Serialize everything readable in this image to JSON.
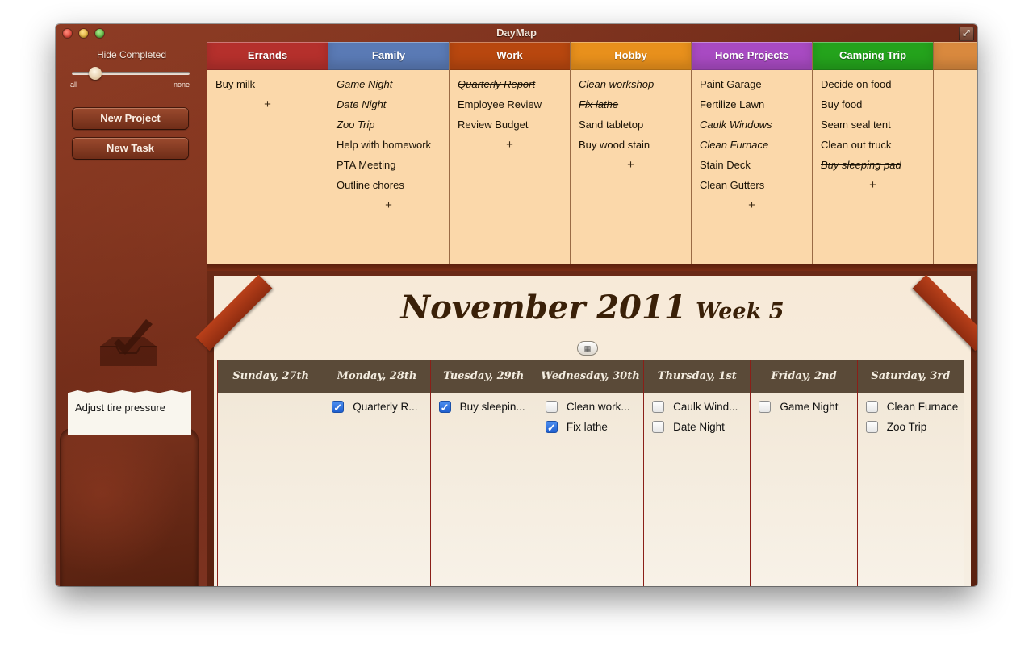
{
  "window": {
    "title": "DayMap"
  },
  "sidebar": {
    "hide_completed_label": "Hide Completed",
    "slider": {
      "min_label": "all",
      "max_label": "none",
      "position": 0.2
    },
    "buttons": {
      "new_project": "New Project",
      "new_task": "New Task"
    },
    "pocket_note": "Adjust tire pressure"
  },
  "projects": [
    {
      "name": "Errands",
      "color": "#b5302c",
      "tasks": [
        {
          "text": "Buy milk",
          "style": "normal"
        }
      ]
    },
    {
      "name": "Family",
      "color": "#5a7ab5",
      "tasks": [
        {
          "text": "Game Night",
          "style": "italic"
        },
        {
          "text": "Date Night",
          "style": "italic"
        },
        {
          "text": "Zoo Trip",
          "style": "italic"
        },
        {
          "text": "Help with homework",
          "style": "normal"
        },
        {
          "text": "PTA Meeting",
          "style": "normal"
        },
        {
          "text": "Outline chores",
          "style": "normal"
        }
      ]
    },
    {
      "name": "Work",
      "color": "#b8470f",
      "tasks": [
        {
          "text": "Quarterly Report",
          "style": "done"
        },
        {
          "text": "Employee Review",
          "style": "normal"
        },
        {
          "text": "Review Budget",
          "style": "normal"
        }
      ]
    },
    {
      "name": "Hobby",
      "color": "#e8901c",
      "tasks": [
        {
          "text": "Clean workshop",
          "style": "italic"
        },
        {
          "text": "Fix lathe",
          "style": "done"
        },
        {
          "text": "Sand tabletop",
          "style": "normal"
        },
        {
          "text": "Buy wood stain",
          "style": "normal"
        }
      ]
    },
    {
      "name": "Home Projects",
      "color": "#a84ac2",
      "tasks": [
        {
          "text": "Paint Garage",
          "style": "normal"
        },
        {
          "text": "Fertilize Lawn",
          "style": "normal"
        },
        {
          "text": "Caulk Windows",
          "style": "italic"
        },
        {
          "text": "Clean Furnace",
          "style": "italic"
        },
        {
          "text": "Stain Deck",
          "style": "normal"
        },
        {
          "text": "Clean Gutters",
          "style": "normal"
        }
      ]
    },
    {
      "name": "Camping Trip",
      "color": "#24a31c",
      "tasks": [
        {
          "text": "Decide on food",
          "style": "normal"
        },
        {
          "text": "Buy food",
          "style": "normal"
        },
        {
          "text": "Seam seal tent",
          "style": "normal"
        },
        {
          "text": "Clean out truck",
          "style": "normal"
        },
        {
          "text": "Buy sleeping pad",
          "style": "done"
        }
      ]
    },
    {
      "name": "",
      "color": "#d9893e",
      "tasks": []
    }
  ],
  "add_task_symbol": "+",
  "calendar": {
    "month": "November 2011",
    "week": "Week 5",
    "toggle_icon": "▦",
    "days": [
      {
        "label": "Sunday, 27th",
        "tasks": []
      },
      {
        "label": "Monday, 28th",
        "tasks": [
          {
            "text": "Quarterly R...",
            "checked": true
          }
        ]
      },
      {
        "label": "Tuesday, 29th",
        "tasks": [
          {
            "text": "Buy sleepin...",
            "checked": true
          }
        ]
      },
      {
        "label": "Wednesday, 30th",
        "tasks": [
          {
            "text": "Clean work...",
            "checked": false
          },
          {
            "text": "Fix lathe",
            "checked": true
          }
        ]
      },
      {
        "label": "Thursday, 1st",
        "tasks": [
          {
            "text": "Caulk Wind...",
            "checked": false
          },
          {
            "text": "Date Night",
            "checked": false
          }
        ]
      },
      {
        "label": "Friday, 2nd",
        "tasks": [
          {
            "text": "Game Night",
            "checked": false
          }
        ]
      },
      {
        "label": "Saturday, 3rd",
        "tasks": [
          {
            "text": "Clean Furnace",
            "checked": false
          },
          {
            "text": "Zoo Trip",
            "checked": false
          }
        ]
      }
    ]
  }
}
